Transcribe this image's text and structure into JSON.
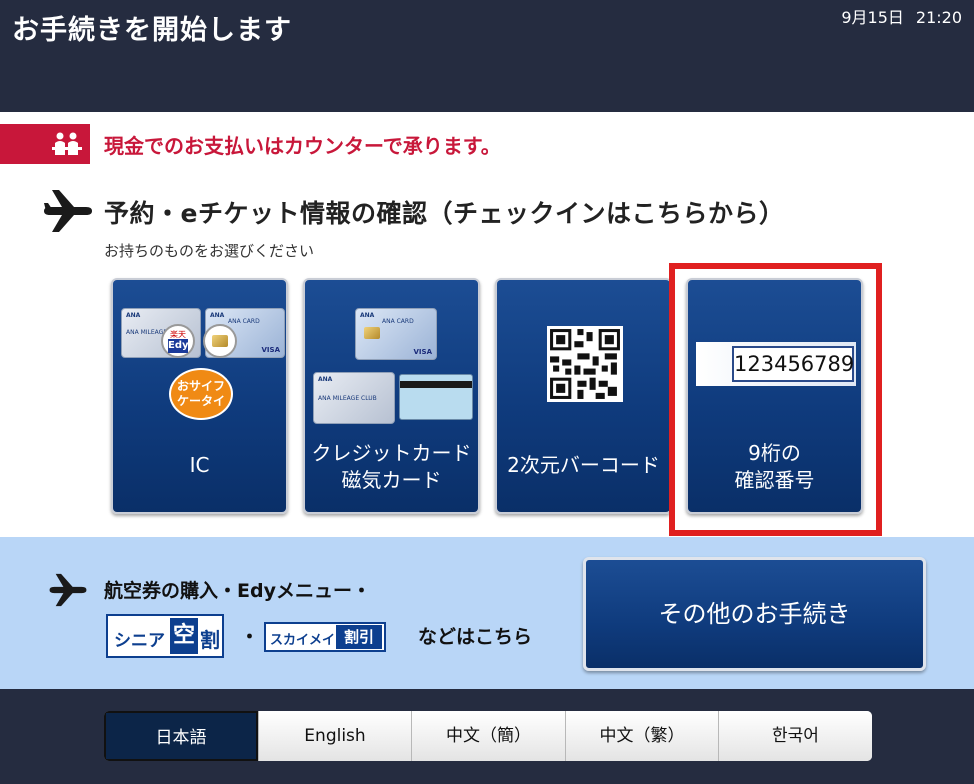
{
  "header": {
    "title": "お手続きを開始します",
    "date": "9月15日",
    "time": "21:20"
  },
  "notice": {
    "text": "現金でのお支払いはカウンターで承ります。",
    "icon": "counter-staff-icon"
  },
  "section": {
    "title": "予約・eチケット情報の確認（チェックインはこちらから）",
    "subtitle": "お持ちのものをお選びください"
  },
  "options": [
    {
      "label": "IC",
      "icon": "ic-card-icon"
    },
    {
      "label_line1": "クレジットカード",
      "label_line2": "磁気カード",
      "icon": "magnetic-card-icon"
    },
    {
      "label": "2次元バーコード",
      "icon": "qr-code-icon"
    },
    {
      "label_line1": "9桁の",
      "label_line2": "確認番号",
      "sample_number": "123456789",
      "highlighted": true
    }
  ],
  "card_art": {
    "ana": "ANA",
    "ana_card": "ANA CARD",
    "mileage_club": "ANA MILEAGE CLUB",
    "visa": "VISA",
    "rakuten": "楽天",
    "edy": "Edy",
    "osaifu_line1": "おサイフ",
    "osaifu_line2": "ケータイ"
  },
  "menu": {
    "line1": "航空券の購入・Edyメニュー・",
    "senior_logo_prefix": "シニア",
    "senior_logo_sky": "空",
    "senior_logo_wari": "割",
    "separator": "・",
    "skymate_logo_text": "スカイメイト",
    "skymate_logo_box": "割引",
    "line2": "などはこちら",
    "other_button": "その他のお手続き"
  },
  "languages": [
    {
      "label": "日本語",
      "active": true
    },
    {
      "label": "English"
    },
    {
      "label": "中文（簡）"
    },
    {
      "label": "中文（繁）"
    },
    {
      "label": "한국어"
    }
  ],
  "colors": {
    "header_bg": "#252c40",
    "accent_red": "#c8173a",
    "button_blue": "#0f3b7d",
    "menu_band": "#b9d6f7",
    "highlight": "#e02020"
  }
}
